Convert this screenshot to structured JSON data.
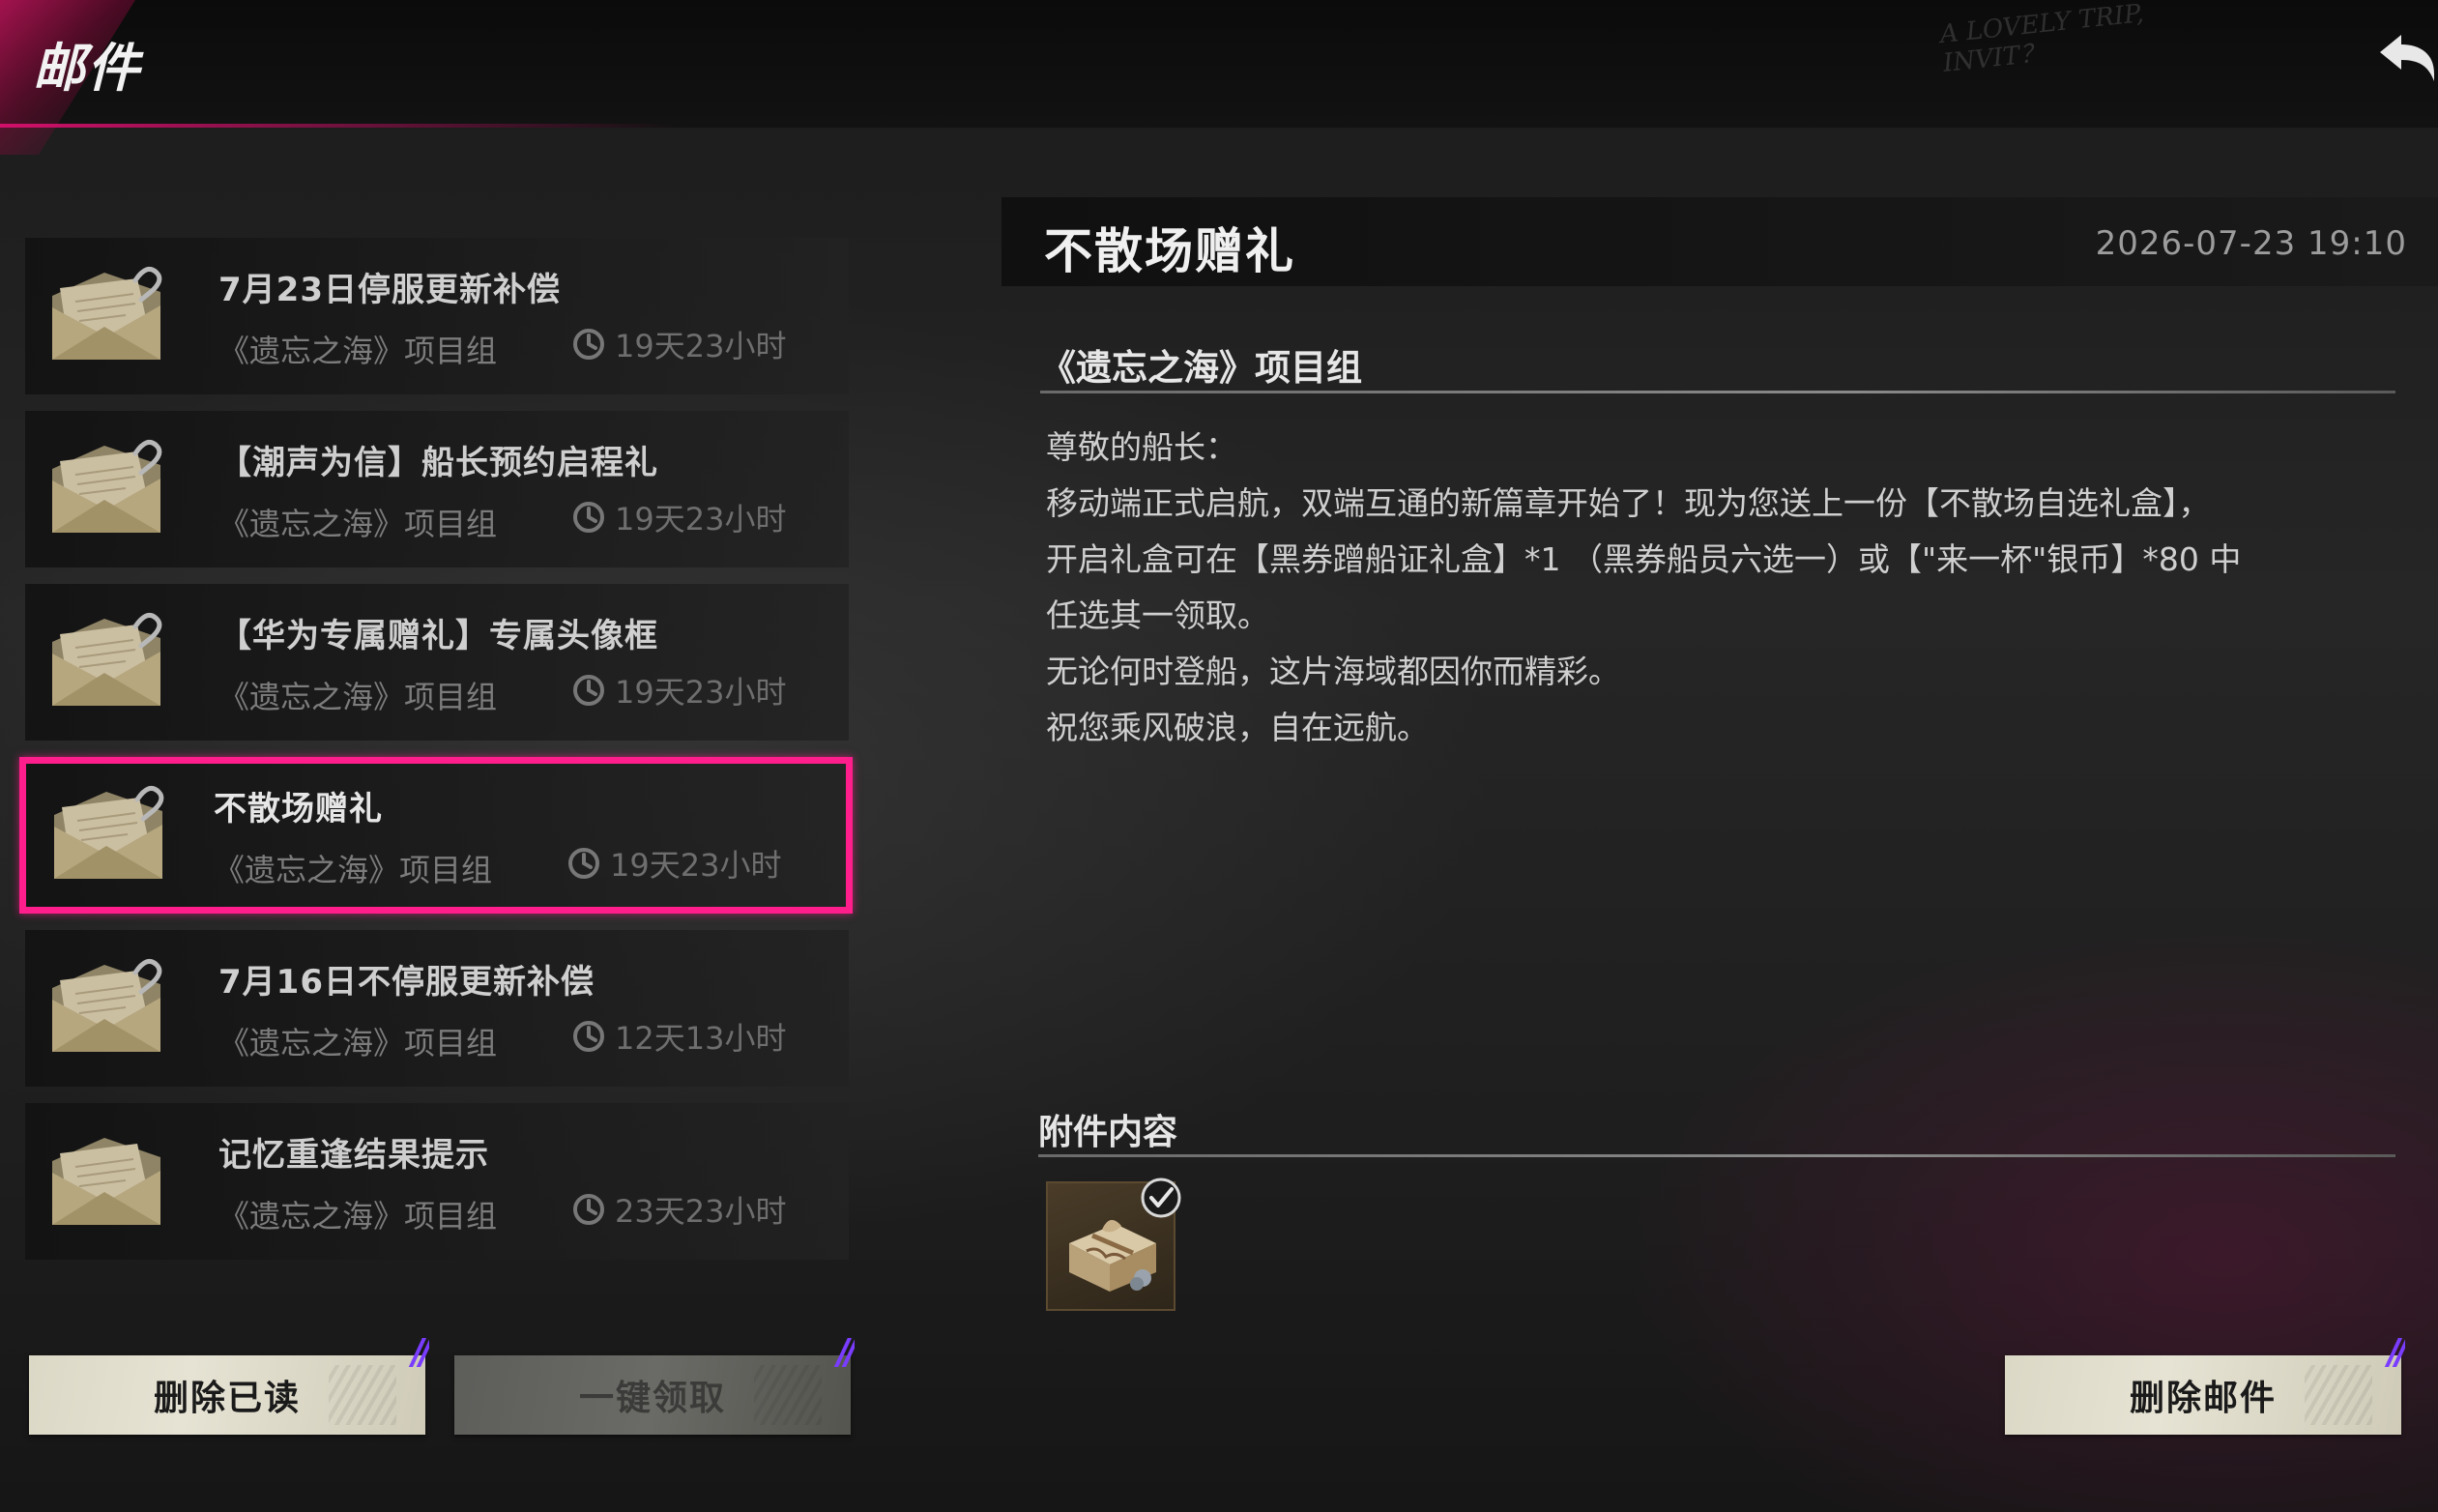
{
  "header": {
    "title": "邮件",
    "scribble": "A LOVELY TRIP,\nINVIT？"
  },
  "mails": [
    {
      "subject": "7月23日停服更新补偿",
      "sender": "《遗忘之海》项目组",
      "expiry": "19天23小时",
      "has_attachment": true,
      "selected": false
    },
    {
      "subject": "【潮声为信】船长预约启程礼",
      "sender": "《遗忘之海》项目组",
      "expiry": "19天23小时",
      "has_attachment": true,
      "selected": false
    },
    {
      "subject": "【华为专属赠礼】专属头像框",
      "sender": "《遗忘之海》项目组",
      "expiry": "19天23小时",
      "has_attachment": true,
      "selected": false
    },
    {
      "subject": "不散场赠礼",
      "sender": "《遗忘之海》项目组",
      "expiry": "19天23小时",
      "has_attachment": true,
      "selected": true
    },
    {
      "subject": "7月16日不停服更新补偿",
      "sender": "《遗忘之海》项目组",
      "expiry": "12天13小时",
      "has_attachment": true,
      "selected": false
    },
    {
      "subject": "记忆重逢结果提示",
      "sender": "《遗忘之海》项目组",
      "expiry": "23天23小时",
      "has_attachment": false,
      "selected": false
    }
  ],
  "buttons": {
    "delete_read": "删除已读",
    "claim_all": "一键领取",
    "delete_mail": "删除邮件"
  },
  "detail": {
    "title": "不散场赠礼",
    "date": "2026-07-23 19:10",
    "sender": "《遗忘之海》项目组",
    "body": [
      "尊敬的船长：",
      "移动端正式启航，双端互通的新篇章开始了！现为您送上一份【不散场自选礼盒】，",
      "开启礼盒可在【黑券蹭船证礼盒】*1 （黑券船员六选一）或【\"来一杯\"银币】*80 中",
      "任选其一领取。",
      "无论何时登船，这片海域都因你而精彩。",
      "祝您乘风破浪，自在远航。"
    ],
    "attachments_heading": "附件内容",
    "attachment_icon": "gift-box-icon",
    "attachment_claimed": true
  },
  "colors": {
    "accent": "#ff1e8c",
    "button": "#e0dccb",
    "button_disabled": "#62625e"
  }
}
